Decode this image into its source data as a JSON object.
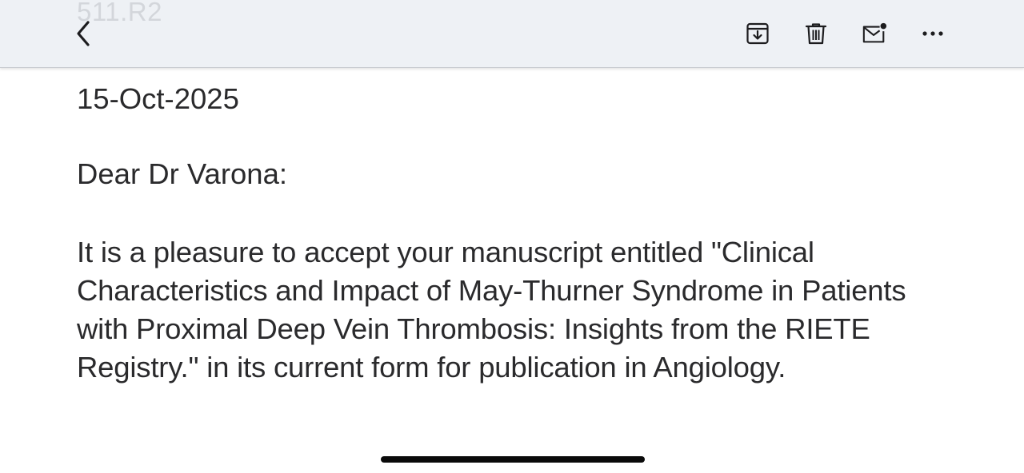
{
  "toolbar": {
    "faded_title": "511.R2",
    "back_icon": "chevron-left-icon",
    "archive_icon": "archive-tray-icon",
    "trash_icon": "trash-icon",
    "mail_icon": "mark-unread-icon",
    "more_icon": "more-dots-icon"
  },
  "message": {
    "date": "15-Oct-2025",
    "greeting": "Dear Dr Varona:",
    "body": "It is a pleasure to accept your manuscript entitled \"Clinical Characteristics and Impact of May-Thurner Syndrome in Patients with Proximal Deep Vein Thrombosis: Insights from the RIETE Registry.\" in its current form for publication in Angiology."
  },
  "colors": {
    "toolbar_bg": "#eef1f5",
    "text": "#2a2a2c",
    "icon": "#1c1c1e"
  }
}
